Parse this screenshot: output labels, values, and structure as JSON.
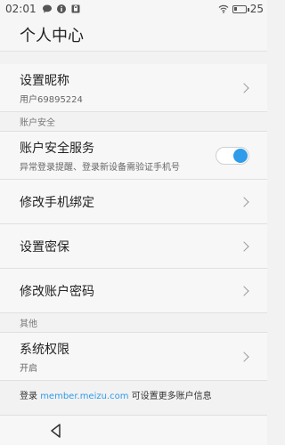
{
  "status_bar": {
    "time": "02:01",
    "battery": "25",
    "battery_level": 0.25,
    "icons": [
      "chat-icon",
      "info-icon",
      "lock-icon",
      "wifi-icon",
      "battery-icon"
    ]
  },
  "header": {
    "title": "个人中心"
  },
  "rows": {
    "nickname": {
      "title": "设置昵称",
      "subtitle": "用户69895224"
    },
    "security_section": "账户安全",
    "security_service": {
      "title": "账户安全服务",
      "subtitle": "异常登录提醒、登录新设备需验证手机号",
      "enabled": true
    },
    "phone_binding": {
      "title": "修改手机绑定"
    },
    "security_question": {
      "title": "设置密保"
    },
    "change_password": {
      "title": "修改账户密码"
    },
    "other_section": "其他",
    "permissions": {
      "title": "系统权限",
      "subtitle": "开启"
    }
  },
  "footer": {
    "prefix": "登录 ",
    "link": "member.meizu.com",
    "suffix": " 可设置更多账户信息"
  },
  "colors": {
    "accent": "#2f9bea"
  }
}
